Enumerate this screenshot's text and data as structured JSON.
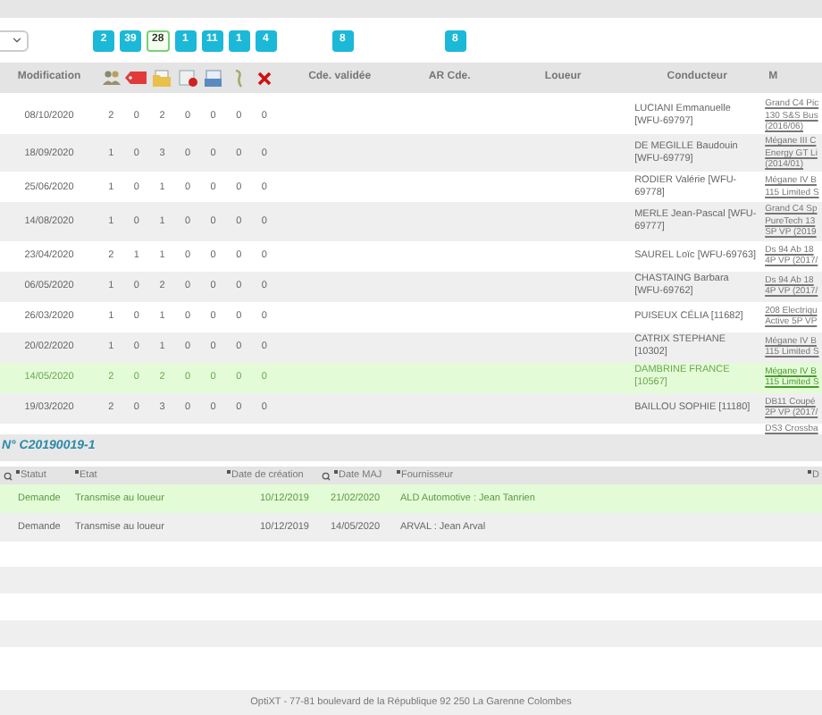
{
  "filter_badges": [
    {
      "label": "2",
      "selected": false
    },
    {
      "label": "39",
      "selected": false
    },
    {
      "label": "28",
      "selected": true
    },
    {
      "label": "1",
      "selected": false
    },
    {
      "label": "11",
      "selected": false
    },
    {
      "label": "1",
      "selected": false
    },
    {
      "label": "4",
      "selected": false
    }
  ],
  "cde_badge": {
    "label": "8",
    "selected": false
  },
  "ar_badge": {
    "label": "8",
    "selected": false
  },
  "table": {
    "columns": [
      "Modification",
      "Cde. validée",
      "AR Cde.",
      "Loueur",
      "Conducteur",
      "M"
    ],
    "icon_columns": [
      {
        "kind": "people"
      },
      {
        "kind": "tag"
      },
      {
        "kind": "folder"
      },
      {
        "kind": "doc-stop"
      },
      {
        "kind": "doc-blue"
      },
      {
        "kind": "hook"
      },
      {
        "kind": "cross"
      }
    ],
    "rows": [
      {
        "modification": "08/10/2020",
        "counts": [
          "2",
          "0",
          "2",
          "0",
          "0",
          "0",
          "0"
        ],
        "conducteur": "LUCIANI Emmanuelle [WFU-69797]",
        "modele": [
          "Grand C4 Pic",
          "130 S&S Bus",
          "(2016/06)"
        ],
        "selected": false
      },
      {
        "modification": "18/09/2020",
        "counts": [
          "1",
          "0",
          "3",
          "0",
          "0",
          "0",
          "0"
        ],
        "conducteur": "DE MEGILLE Baudouin [WFU-69779]",
        "modele": [
          "Mégane III C",
          "Energy GT Li",
          "(2014/01)"
        ],
        "selected": false
      },
      {
        "modification": "25/06/2020",
        "counts": [
          "1",
          "0",
          "1",
          "0",
          "0",
          "0",
          "0"
        ],
        "conducteur": "RODIER Valérie [WFU-69778]",
        "modele": [
          "Mégane IV B",
          "115 Limited S"
        ],
        "selected": false
      },
      {
        "modification": "14/08/2020",
        "counts": [
          "1",
          "0",
          "1",
          "0",
          "0",
          "0",
          "0"
        ],
        "conducteur": "MERLE Jean-Pascal [WFU-69777]",
        "modele": [
          "Grand C4 Sp",
          "PureTech 13",
          "SP VP (2019"
        ],
        "selected": false
      },
      {
        "modification": "23/04/2020",
        "counts": [
          "2",
          "1",
          "1",
          "0",
          "0",
          "0",
          "0"
        ],
        "conducteur": "SAUREL Loïc [WFU-69763]",
        "modele": [
          "Ds 94 Ab 18",
          "4P VP (2017/"
        ],
        "selected": false
      },
      {
        "modification": "06/05/2020",
        "counts": [
          "1",
          "0",
          "2",
          "0",
          "0",
          "0",
          "0"
        ],
        "conducteur": "CHASTAING Barbara [WFU-69762]",
        "modele": [
          "Ds 94 Ab 18",
          "4P VP (2017/"
        ],
        "selected": false
      },
      {
        "modification": "26/03/2020",
        "counts": [
          "1",
          "0",
          "1",
          "0",
          "0",
          "0",
          "0"
        ],
        "conducteur": "PUISEUX CÉLIA [11682]",
        "modele": [
          "208 Electriqu",
          "Active 5P VP"
        ],
        "selected": false
      },
      {
        "modification": "20/02/2020",
        "counts": [
          "1",
          "0",
          "1",
          "0",
          "0",
          "0",
          "0"
        ],
        "conducteur": "CATRIX STEPHANE [10302]",
        "modele": [
          "Mégane IV B",
          "115 Limited S"
        ],
        "selected": false
      },
      {
        "modification": "14/05/2020",
        "counts": [
          "2",
          "0",
          "2",
          "0",
          "0",
          "0",
          "0"
        ],
        "conducteur": "DAMBRINE FRANCE [10567]",
        "modele": [
          "Mégane IV B",
          "115 Limited S"
        ],
        "selected": true
      },
      {
        "modification": "19/03/2020",
        "counts": [
          "2",
          "0",
          "3",
          "0",
          "0",
          "0",
          "0"
        ],
        "conducteur": "BAILLOU SOPHIE [11180]",
        "modele": [
          "DB11 Coupé",
          "2P VP (2017/"
        ],
        "selected": false
      }
    ],
    "partial_row": {
      "modele": "DS3 Crossba"
    }
  },
  "detail": {
    "title": "N° C20190019-1",
    "columns": [
      {
        "label": "Statut",
        "search": true
      },
      {
        "label": "Etat",
        "search": false
      },
      {
        "label": "Date de création",
        "search": false
      },
      {
        "label": "Date MAJ",
        "search": true
      },
      {
        "label": "Fournisseur",
        "search": false
      },
      {
        "label": "D",
        "search": false
      }
    ],
    "rows": [
      {
        "statut": "Demande",
        "etat": "Transmise au loueur",
        "creation": "10/12/2019",
        "maj": "21/02/2020",
        "fournisseur": "ALD Automotive : Jean Tanrien",
        "selected": true
      },
      {
        "statut": "Demande",
        "etat": "Transmise au loueur",
        "creation": "10/12/2019",
        "maj": "14/05/2020",
        "fournisseur": "ARVAL : Jean Arval",
        "selected": false
      }
    ]
  },
  "footer": "OptiXT - 77-81 boulevard de la République 92 250 La Garenne Colombes"
}
